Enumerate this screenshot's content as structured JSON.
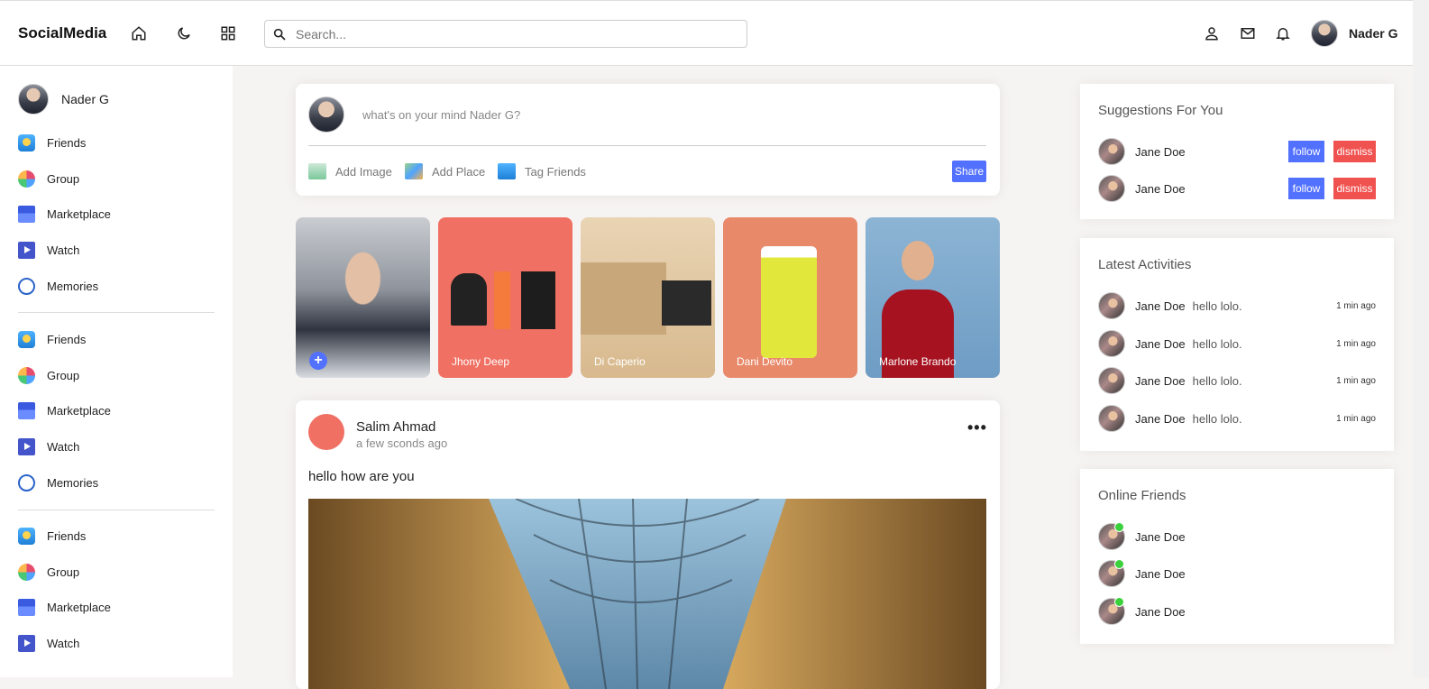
{
  "header": {
    "logo": "SocialMedia",
    "search_placeholder": "Search...",
    "username": "Nader G"
  },
  "sidebar": {
    "username": "Nader G",
    "groups": [
      [
        "Friends",
        "Group",
        "Marketplace",
        "Watch",
        "Memories"
      ],
      [
        "Friends",
        "Group",
        "Marketplace",
        "Watch",
        "Memories"
      ],
      [
        "Friends",
        "Group",
        "Marketplace",
        "Watch"
      ]
    ]
  },
  "share": {
    "placeholder": "what's on your mind Nader G?",
    "add_image": "Add Image",
    "add_place": "Add Place",
    "tag_friends": "Tag Friends",
    "share_button": "Share"
  },
  "stories": [
    "",
    "Jhony Deep",
    "Di Caperio",
    "Dani Devito",
    "Marlone Brando"
  ],
  "post": {
    "author": "Salim Ahmad",
    "time": "a few sconds ago",
    "text": "hello how are you",
    "more": "•••"
  },
  "suggestions": {
    "title": "Suggestions For You",
    "items": [
      {
        "name": "Jane Doe",
        "follow": "follow",
        "dismiss": "dismiss"
      },
      {
        "name": "Jane Doe",
        "follow": "follow",
        "dismiss": "dismiss"
      }
    ]
  },
  "activities": {
    "title": "Latest Activities",
    "items": [
      {
        "name": "Jane Doe",
        "msg": "hello lolo.",
        "time": "1 min ago"
      },
      {
        "name": "Jane Doe",
        "msg": "hello lolo.",
        "time": "1 min ago"
      },
      {
        "name": "Jane Doe",
        "msg": "hello lolo.",
        "time": "1 min ago"
      },
      {
        "name": "Jane Doe",
        "msg": "hello lolo.",
        "time": "1 min ago"
      }
    ]
  },
  "online": {
    "title": "Online Friends",
    "items": [
      {
        "name": "Jane Doe"
      },
      {
        "name": "Jane Doe"
      },
      {
        "name": "Jane Doe"
      }
    ]
  },
  "colors": {
    "accent": "#5271ff",
    "dismiss": "#f0524f",
    "online": "#3bd13b"
  }
}
